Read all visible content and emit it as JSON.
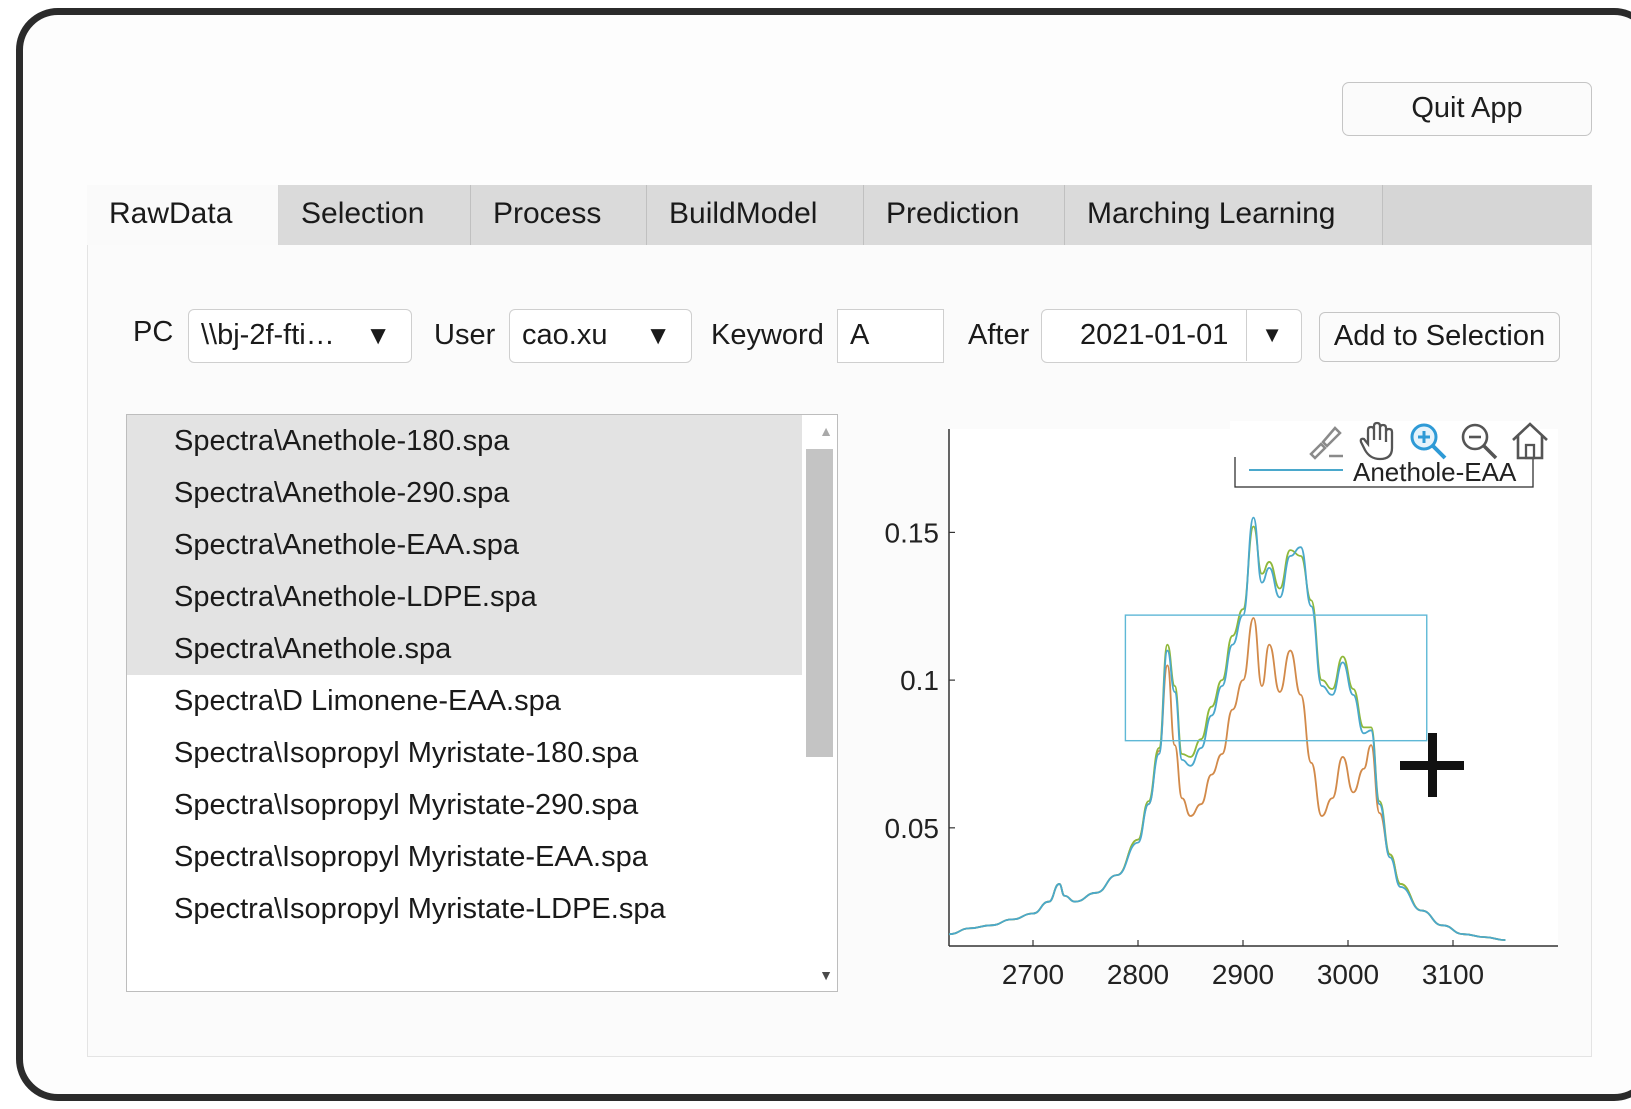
{
  "quit_label": "Quit App",
  "tabs": [
    {
      "label": "RawData"
    },
    {
      "label": "Selection"
    },
    {
      "label": "Process"
    },
    {
      "label": "BuildModel"
    },
    {
      "label": "Prediction"
    },
    {
      "label": "Marching Learning"
    }
  ],
  "filters": {
    "pc_label": "PC",
    "pc_value": "\\\\bj-2f-fti…",
    "user_label": "User",
    "user_value": "cao.xu",
    "keyword_label": "Keyword",
    "keyword_value": "A",
    "after_label": "After",
    "after_value": "2021-01-01",
    "add_label": "Add to Selection"
  },
  "files": [
    {
      "name": "Spectra\\Anethole-180.spa",
      "selected": true
    },
    {
      "name": "Spectra\\Anethole-290.spa",
      "selected": true
    },
    {
      "name": "Spectra\\Anethole-EAA.spa",
      "selected": true
    },
    {
      "name": "Spectra\\Anethole-LDPE.spa",
      "selected": true
    },
    {
      "name": "Spectra\\Anethole.spa",
      "selected": true
    },
    {
      "name": "Spectra\\D Limonene-EAA.spa",
      "selected": false
    },
    {
      "name": "Spectra\\Isopropyl Myristate-180.spa",
      "selected": false
    },
    {
      "name": "Spectra\\Isopropyl Myristate-290.spa",
      "selected": false
    },
    {
      "name": "Spectra\\Isopropyl Myristate-EAA.spa",
      "selected": false
    },
    {
      "name": "Spectra\\Isopropyl Myristate-LDPE.spa",
      "selected": false
    }
  ],
  "toolbar_icons": [
    "brush-icon",
    "pan-hand-icon",
    "zoom-in-icon",
    "zoom-out-icon",
    "home-icon"
  ],
  "chart_data": {
    "type": "line",
    "xlim": [
      2620,
      3200
    ],
    "ylim": [
      0.01,
      0.185
    ],
    "xticks": [
      2700,
      2800,
      2900,
      3000,
      3100
    ],
    "xtick_labels": [
      "2700",
      "2800",
      "2900",
      "3000",
      "3100"
    ],
    "yticks": [
      0.05,
      0.1,
      0.15
    ],
    "ytick_labels": [
      "0.05",
      "0.1",
      "0.15"
    ],
    "legend": {
      "entries": [
        "Anethole-EAA"
      ],
      "placement": "top-right"
    },
    "zoom_box": {
      "x": [
        2788,
        3075
      ],
      "y": [
        0.0795,
        0.122
      ]
    },
    "series": [
      {
        "color": "#4aa8cc",
        "x": [
          2620,
          2640,
          2660,
          2680,
          2700,
          2715,
          2725,
          2730,
          2740,
          2760,
          2780,
          2800,
          2810,
          2820,
          2828,
          2835,
          2842,
          2850,
          2860,
          2870,
          2880,
          2890,
          2900,
          2910,
          2918,
          2925,
          2935,
          2945,
          2955,
          2965,
          2975,
          2985,
          2995,
          3005,
          3015,
          3022,
          3030,
          3040,
          3050,
          3070,
          3090,
          3110,
          3130,
          3150
        ],
        "y": [
          0.014,
          0.016,
          0.017,
          0.019,
          0.021,
          0.025,
          0.031,
          0.027,
          0.025,
          0.028,
          0.034,
          0.045,
          0.058,
          0.075,
          0.11,
          0.096,
          0.073,
          0.071,
          0.077,
          0.088,
          0.098,
          0.112,
          0.122,
          0.155,
          0.133,
          0.138,
          0.128,
          0.142,
          0.145,
          0.125,
          0.098,
          0.095,
          0.106,
          0.095,
          0.082,
          0.083,
          0.058,
          0.04,
          0.03,
          0.022,
          0.017,
          0.014,
          0.013,
          0.012
        ]
      },
      {
        "color": "#8fb83a",
        "x": [
          2620,
          2640,
          2660,
          2680,
          2700,
          2715,
          2725,
          2730,
          2740,
          2760,
          2780,
          2800,
          2810,
          2820,
          2828,
          2835,
          2842,
          2850,
          2860,
          2870,
          2880,
          2890,
          2900,
          2910,
          2918,
          2925,
          2935,
          2945,
          2955,
          2965,
          2975,
          2985,
          2995,
          3005,
          3015,
          3022,
          3030,
          3040,
          3050,
          3070,
          3090,
          3110,
          3130,
          3150
        ],
        "y": [
          0.014,
          0.016,
          0.017,
          0.019,
          0.021,
          0.025,
          0.031,
          0.027,
          0.025,
          0.028,
          0.034,
          0.046,
          0.059,
          0.077,
          0.112,
          0.098,
          0.075,
          0.074,
          0.08,
          0.091,
          0.1,
          0.115,
          0.124,
          0.152,
          0.136,
          0.14,
          0.131,
          0.144,
          0.142,
          0.127,
          0.1,
          0.097,
          0.108,
          0.097,
          0.084,
          0.084,
          0.059,
          0.041,
          0.031,
          0.022,
          0.017,
          0.014,
          0.013,
          0.012
        ]
      },
      {
        "color": "#d28a4a",
        "x": [
          2620,
          2640,
          2660,
          2680,
          2700,
          2715,
          2725,
          2730,
          2740,
          2760,
          2780,
          2800,
          2810,
          2820,
          2828,
          2835,
          2842,
          2850,
          2860,
          2870,
          2880,
          2890,
          2900,
          2910,
          2918,
          2925,
          2935,
          2945,
          2955,
          2965,
          2975,
          2985,
          2995,
          3005,
          3015,
          3022,
          3030,
          3040,
          3050,
          3070,
          3090,
          3110,
          3130,
          3150
        ],
        "y": [
          0.014,
          0.016,
          0.017,
          0.019,
          0.021,
          0.025,
          0.031,
          0.027,
          0.025,
          0.028,
          0.034,
          0.046,
          0.058,
          0.076,
          0.105,
          0.078,
          0.06,
          0.054,
          0.058,
          0.068,
          0.075,
          0.09,
          0.1,
          0.121,
          0.098,
          0.112,
          0.096,
          0.11,
          0.095,
          0.072,
          0.054,
          0.06,
          0.074,
          0.062,
          0.07,
          0.078,
          0.055,
          0.041,
          0.031,
          0.022,
          0.017,
          0.014,
          0.013,
          0.012
        ]
      }
    ]
  }
}
